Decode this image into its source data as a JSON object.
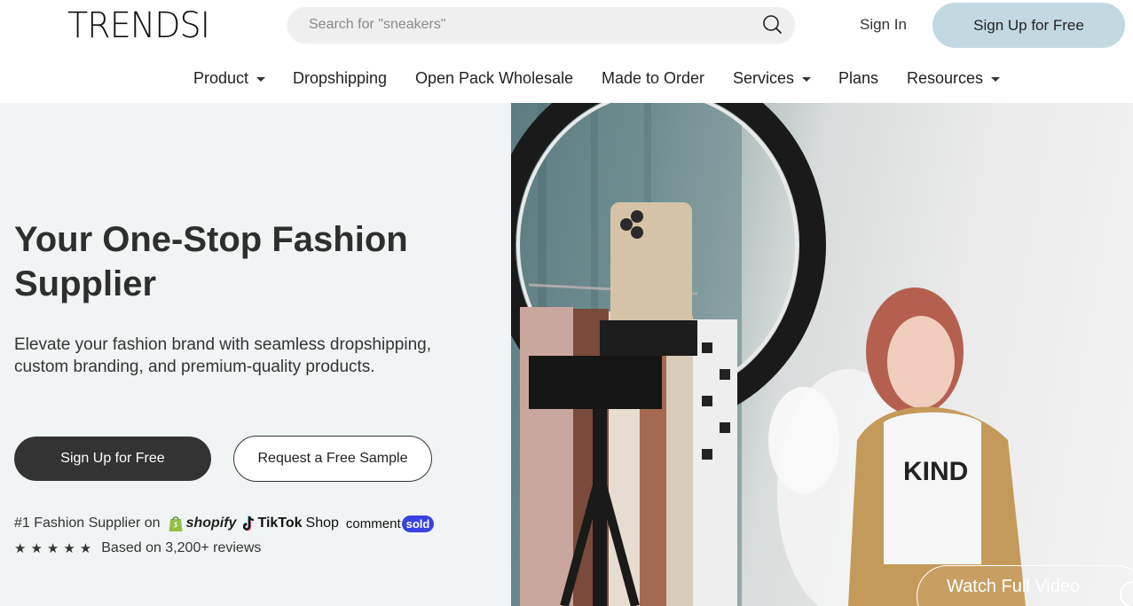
{
  "header": {
    "logo": "TRENDSI",
    "search": {
      "placeholder": "Search for \"sneakers\""
    },
    "sign_in": "Sign In",
    "sign_up": "Sign Up for Free"
  },
  "nav": {
    "items": [
      {
        "label": "Product",
        "has_dropdown": true
      },
      {
        "label": "Dropshipping",
        "has_dropdown": false
      },
      {
        "label": "Open Pack Wholesale",
        "has_dropdown": false
      },
      {
        "label": "Made to Order",
        "has_dropdown": false
      },
      {
        "label": "Services",
        "has_dropdown": true
      },
      {
        "label": "Plans",
        "has_dropdown": false
      },
      {
        "label": "Resources",
        "has_dropdown": true
      }
    ]
  },
  "hero": {
    "headline": "Your One-Stop Fashion Supplier",
    "subhead": "Elevate your fashion brand with seamless dropshipping, custom branding, and premium-quality products.",
    "primary_cta": "Sign Up for Free",
    "secondary_cta": "Request a Free Sample",
    "supplier_prefix": "#1 Fashion Supplier on",
    "platforms": {
      "shopify": "shopify",
      "tiktok": "TikTok",
      "tiktok_shop": "Shop",
      "comment": "comment",
      "sold": "sold"
    },
    "rating_stars": 5,
    "stars_glyphs": "★★★★★",
    "reviews": "Based on 3,200+ reviews",
    "shirt_text": "KIND",
    "watch_video": "Watch Full Video"
  },
  "colors": {
    "signup_top_bg": "#c3d9e2",
    "primary_btn_bg": "#333333",
    "hero_left_bg": "#f1f4f5",
    "commentsold_badge": "#3b40e0"
  }
}
